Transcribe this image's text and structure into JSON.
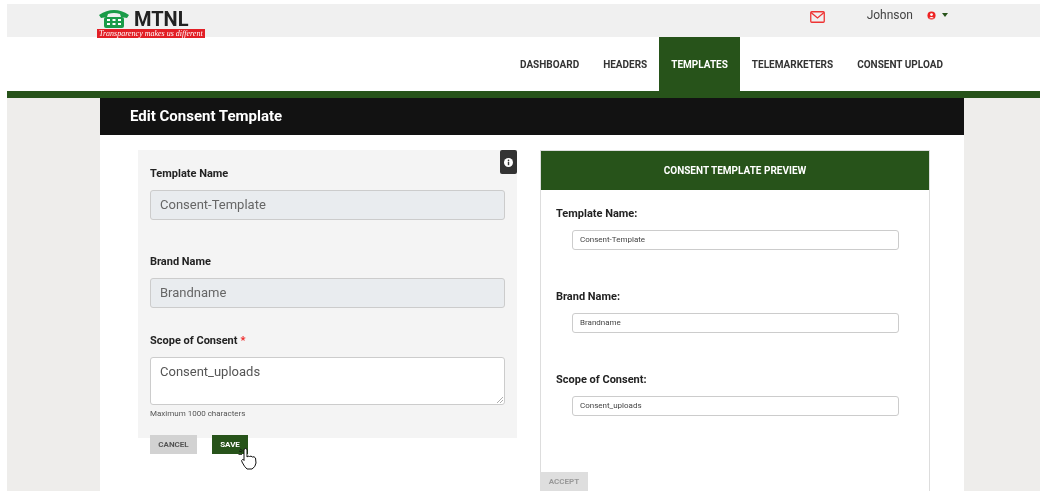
{
  "header": {
    "logo_text": "MTNL",
    "tagline": "Transparency makes us different",
    "user_name": "Johnson"
  },
  "nav": [
    {
      "label": "DASHBOARD",
      "selected": false
    },
    {
      "label": "HEADERS",
      "selected": false
    },
    {
      "label": "TEMPLATES",
      "selected": true
    },
    {
      "label": "TELEMARKETERS",
      "selected": false
    },
    {
      "label": "CONSENT UPLOAD",
      "selected": false
    }
  ],
  "page_title": "Edit Consent Template",
  "form": {
    "fields": [
      {
        "kind": "input",
        "label": "Template Name",
        "value": "Consent-Template",
        "disabled": true
      },
      {
        "kind": "input",
        "label": "Brand Name",
        "value": "Brandname",
        "disabled": true
      },
      {
        "kind": "textarea",
        "label": "Scope of Consent",
        "value": "Consent_uploads",
        "disabled": false,
        "required_mark": "*",
        "hint": "Maximum 1000 characters"
      }
    ],
    "buttons": [
      {
        "kind": "secondary",
        "label": "CANCEL"
      },
      {
        "kind": "primary",
        "label": "SAVE"
      }
    ]
  },
  "preview": {
    "title": "CONSENT TEMPLATE PREVIEW",
    "fields": [
      {
        "label": "Template Name:",
        "value": "Consent-Template"
      },
      {
        "label": "Brand Name:",
        "value": "Brandname"
      },
      {
        "label": "Scope of Consent:",
        "value": "Consent_uploads"
      }
    ],
    "accept_button": {
      "label": "ACCEPT",
      "disabled": true
    }
  }
}
